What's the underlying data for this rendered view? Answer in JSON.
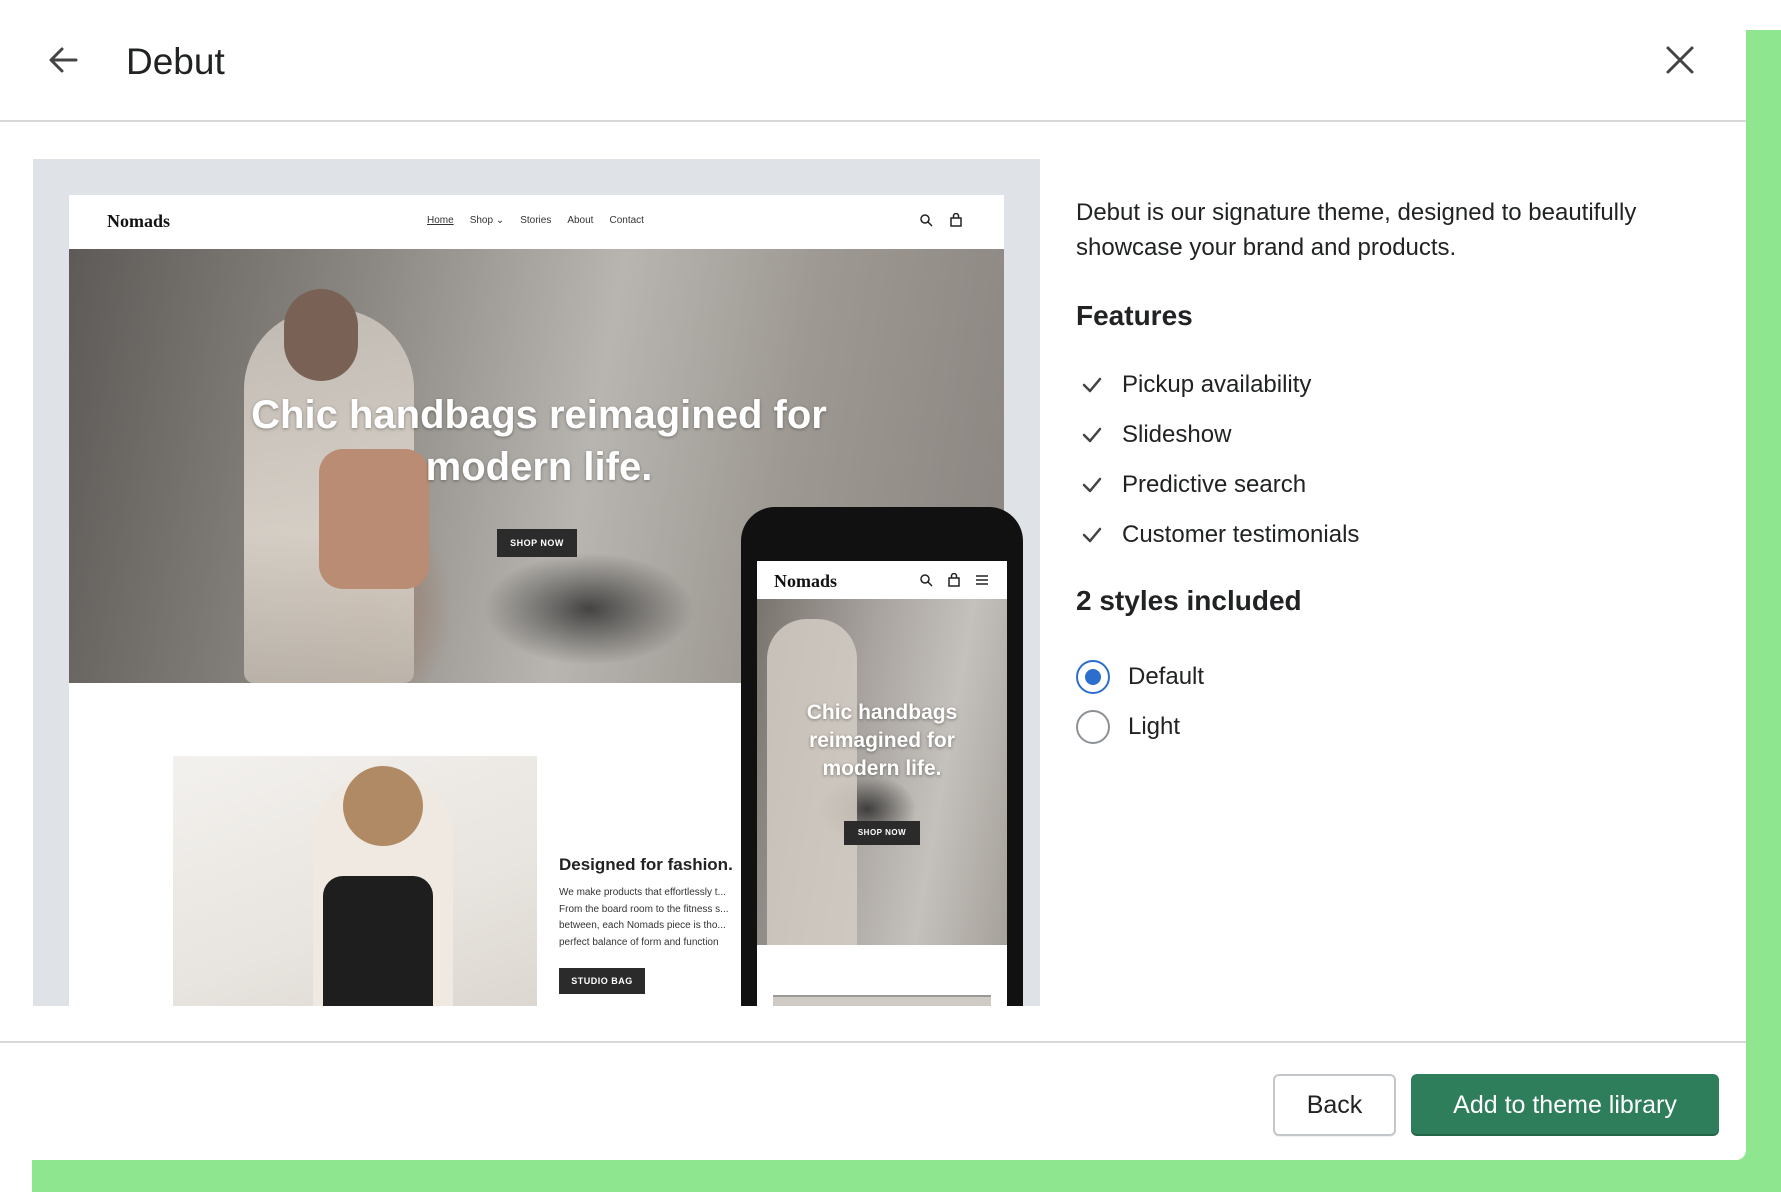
{
  "header": {
    "title": "Debut",
    "back_icon": "arrow-left-icon",
    "close_icon": "close-icon"
  },
  "preview": {
    "desktop": {
      "logo": "Nomads",
      "nav_links": [
        "Home",
        "Shop ⌄",
        "Stories",
        "About",
        "Contact"
      ],
      "hero_heading": "Chic handbags reimagined for modern life.",
      "hero_button": "SHOP NOW",
      "feature_heading": "Designed for fashion.",
      "feature_body": "We make products that effortlessly t... From the board room to the fitness s... between, each Nomads piece is tho... perfect balance of form and function",
      "feature_button": "STUDIO BAG"
    },
    "mobile": {
      "logo": "Nomads",
      "hero_heading": "Chic handbags reimagined for modern life.",
      "hero_button": "SHOP NOW"
    }
  },
  "details": {
    "description": "Debut is our signature theme, designed to beautifully showcase your brand and products.",
    "features_heading": "Features",
    "features": [
      "Pickup availability",
      "Slideshow",
      "Predictive search",
      "Customer testimonials"
    ],
    "styles_heading": "2 styles included",
    "styles": [
      {
        "label": "Default",
        "selected": true
      },
      {
        "label": "Light",
        "selected": false
      }
    ]
  },
  "footer": {
    "back_label": "Back",
    "add_label": "Add to theme library"
  },
  "colors": {
    "primary_button": "#2e7d5b",
    "radio_selected": "#2c6ecb",
    "frame_accent": "#8ee68f"
  }
}
